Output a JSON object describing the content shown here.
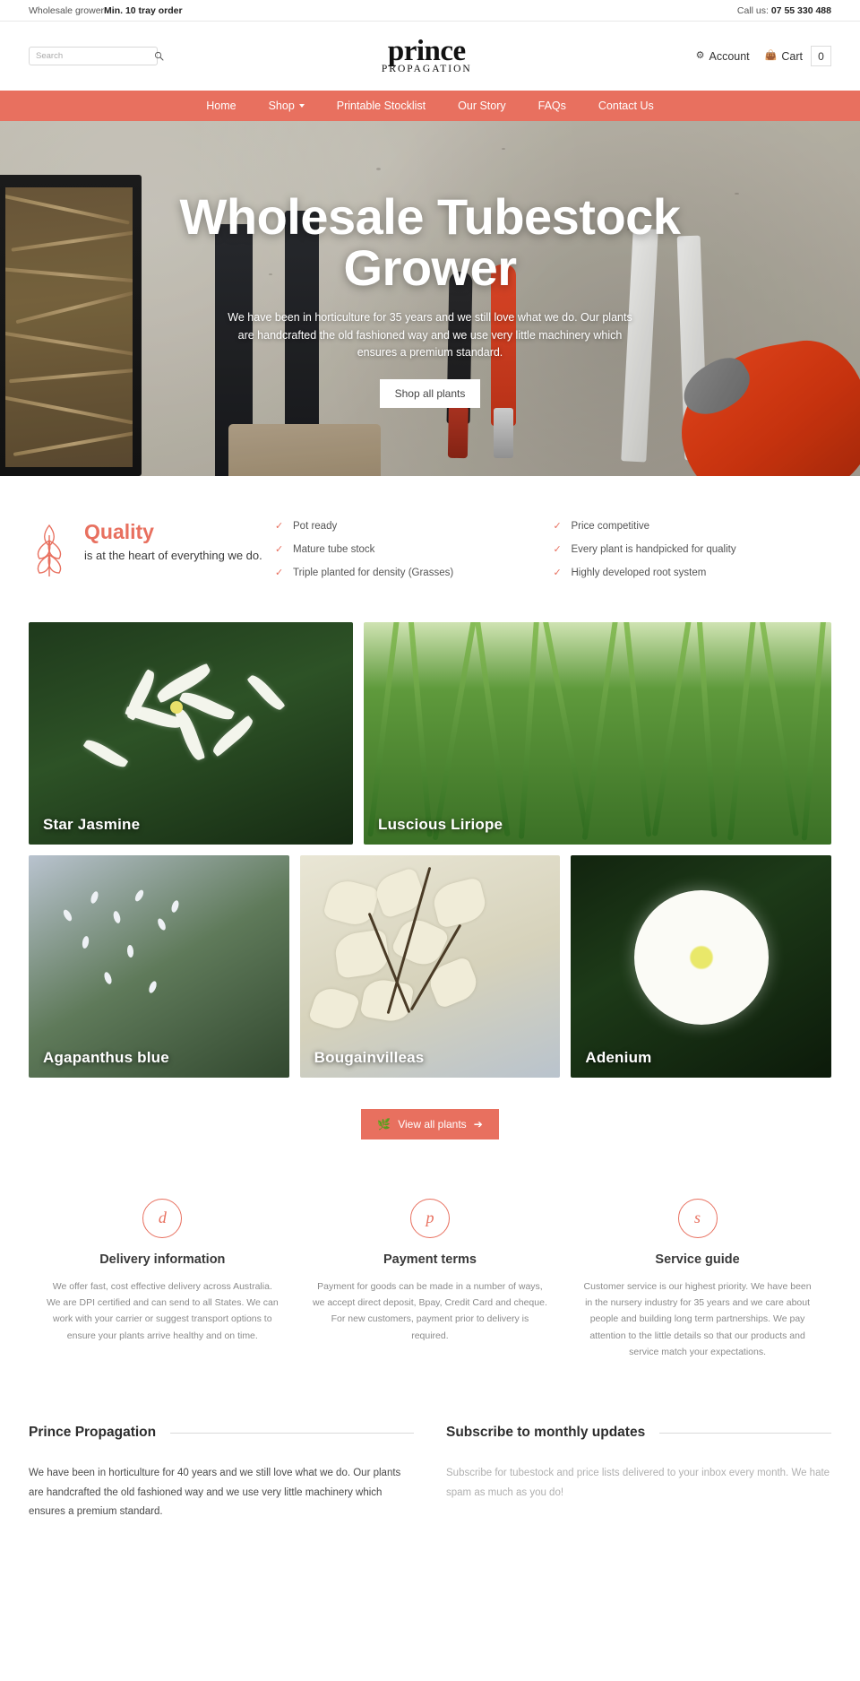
{
  "topbar": {
    "left_normal": "Wholesale grower",
    "left_bold": "Min. 10 tray order",
    "right_prefix": "Call us: ",
    "phone": "07 55 330 488"
  },
  "header": {
    "search_placeholder": "Search",
    "search_value": "",
    "logo_main": "prince",
    "logo_sub": "PROPAGATION",
    "account_label": "Account",
    "cart_label": "Cart",
    "cart_count": "0"
  },
  "nav": {
    "items": [
      {
        "label": "Home",
        "has_caret": false
      },
      {
        "label": "Shop",
        "has_caret": true
      },
      {
        "label": "Printable Stocklist",
        "has_caret": false
      },
      {
        "label": "Our Story",
        "has_caret": false
      },
      {
        "label": "FAQs",
        "has_caret": false
      },
      {
        "label": "Contact Us",
        "has_caret": false
      }
    ]
  },
  "hero": {
    "title": "Wholesale Tubestock Grower",
    "subtitle": "We have been in horticulture for 35 years and we still love what we do. Our plants are handcrafted the old fashioned way and we use very little machinery which ensures a premium standard.",
    "button": "Shop all plants"
  },
  "quality": {
    "title": "Quality",
    "text": "is at the heart of everything we do.",
    "col1": [
      "Pot ready",
      "Mature tube stock",
      "Triple planted for density (Grasses)"
    ],
    "col2": [
      "Price competitive",
      "Every plant is handpicked for quality",
      "Highly developed root system"
    ]
  },
  "gallery": {
    "row1": [
      {
        "label": "Star Jasmine"
      },
      {
        "label": "Luscious Liriope"
      }
    ],
    "row2": [
      {
        "label": "Agapanthus blue"
      },
      {
        "label": "Bougainvilleas"
      },
      {
        "label": "Adenium"
      }
    ],
    "view_all": "View all plants"
  },
  "infos": [
    {
      "letter": "d",
      "title": "Delivery information",
      "body": "We offer fast, cost effective delivery across Australia. We are DPI certified and can send to all States. We can work with your carrier or suggest transport options to ensure your plants arrive healthy and on time."
    },
    {
      "letter": "p",
      "title": "Payment terms",
      "body": "Payment for goods can be made in a number of ways, we accept direct deposit, Bpay, Credit Card and cheque. For new customers, payment prior to delivery is required."
    },
    {
      "letter": "s",
      "title": "Service guide",
      "body": "Customer service is our highest priority. We have been in the nursery industry for 35 years and we care about people and building long term partnerships. We pay attention to the little details so that our products and service match your expectations."
    }
  ],
  "footer": {
    "col1_title": "Prince Propagation",
    "col1_body": "We have been in horticulture for 40 years and we still love what we do. Our plants are handcrafted the old fashioned way and we use very little machinery which ensures a premium standard.",
    "col2_title": "Subscribe to monthly updates",
    "col2_body": "Subscribe for tubestock and price lists delivered to your inbox every month. We hate spam as much as you do!"
  },
  "colors": {
    "accent": "#e8705f",
    "text": "#444444"
  }
}
